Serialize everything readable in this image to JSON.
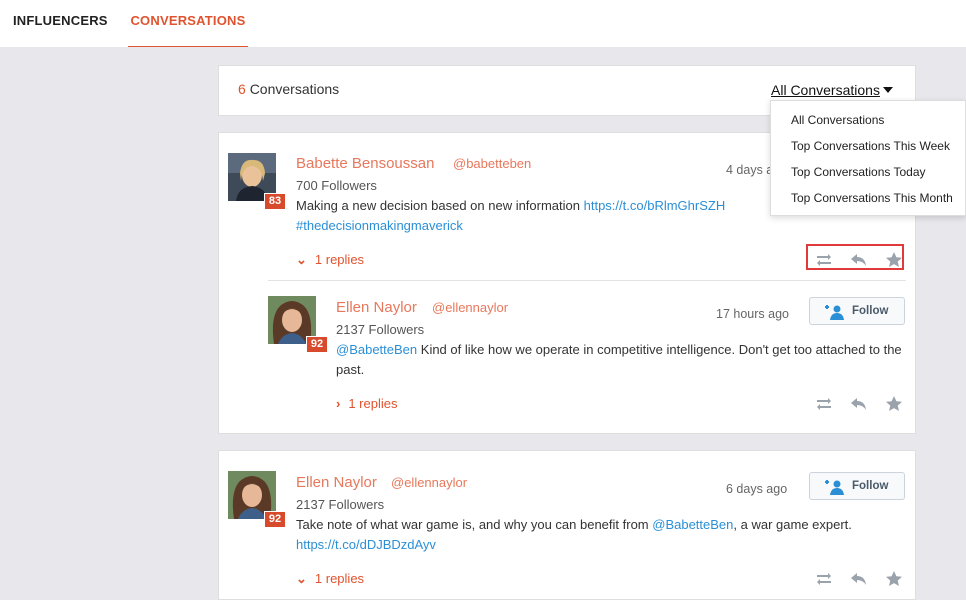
{
  "tabs": [
    {
      "label": "INFLUENCERS"
    },
    {
      "label": "CONVERSATIONS"
    }
  ],
  "header": {
    "count": "6",
    "count_label": "Conversations",
    "filter_label": "All Conversations"
  },
  "dropdown": {
    "options": [
      "All Conversations",
      "Top Conversations This Week",
      "Top Conversations Today",
      "Top Conversations This Month"
    ]
  },
  "posts": [
    {
      "name": "Babette Bensoussan",
      "handle": "@babetteben",
      "followers": "700 Followers",
      "time": "4 days ago",
      "score": "83",
      "text": "Making a new decision based on new information ",
      "link1": "https://t.co/bRlmGhrSZH",
      "link2": "#thedecisionmakingmaverick",
      "replies": "1 replies"
    },
    {
      "name": "Ellen Naylor",
      "handle": "@ellennaylor",
      "followers": "2137 Followers",
      "time": "17 hours ago",
      "score": "92",
      "mention": "@BabetteBen",
      "text": " Kind of like how we operate in competitive intelligence. Don't get too attached to the past.",
      "replies": "1 replies",
      "follow_label": "Follow"
    },
    {
      "name": "Ellen Naylor",
      "handle": "@ellennaylor",
      "followers": "2137 Followers",
      "time": "6 days ago",
      "score": "92",
      "text": "Take note of what war game is, and why you can benefit from ",
      "mention": "@BabetteBen",
      "text2": ", a war game expert.",
      "link1": "https://t.co/dDJBDzdAyv",
      "replies": "1 replies",
      "follow_label": "Follow"
    }
  ],
  "icons": {
    "retweet": "retweet-icon",
    "reply": "reply-icon",
    "favorite": "star-icon",
    "add_user": "add-user-icon"
  },
  "colors": {
    "accent": "#e0532f",
    "name": "#e7785c",
    "link": "#2b8fd6",
    "score": "#d84a2c",
    "highlight": "#e03a3a"
  }
}
